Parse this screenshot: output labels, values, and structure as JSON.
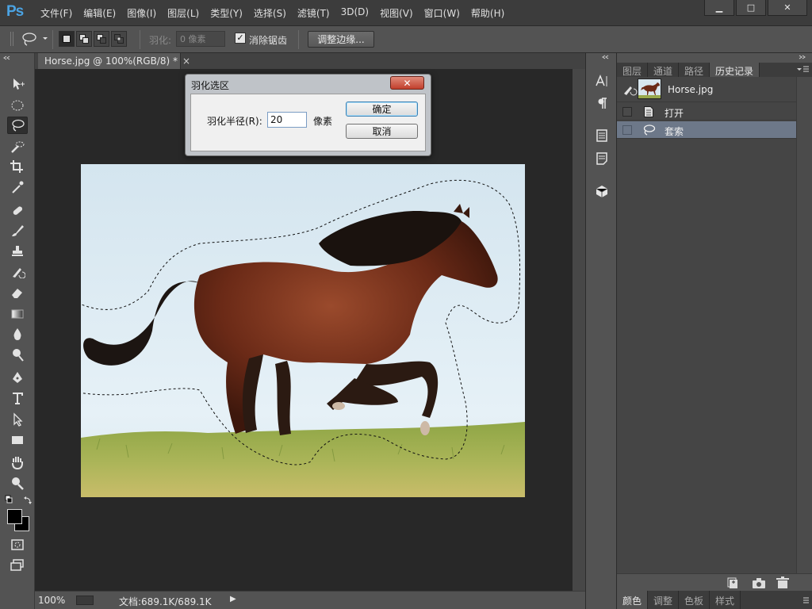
{
  "app": {
    "logo": "Ps"
  },
  "menus": [
    "文件(F)",
    "编辑(E)",
    "图像(I)",
    "图层(L)",
    "类型(Y)",
    "选择(S)",
    "滤镜(T)",
    "3D(D)",
    "视图(V)",
    "窗口(W)",
    "帮助(H)"
  ],
  "window_controls": {
    "minimize": "▁",
    "maximize": "□",
    "close": "✕"
  },
  "options": {
    "feather_label": "羽化:",
    "feather_value": "0 像素",
    "antialias_label": "消除锯齿",
    "antialias_checked": true,
    "antialias_mark": "✓",
    "refine_edge_label": "调整边缘..."
  },
  "document": {
    "tab_title": "Horse.jpg @ 100%(RGB/8) *",
    "tab_close": "×",
    "zoom": "100%",
    "doc_size": "文档:689.1K/689.1K"
  },
  "panel_tabs": [
    "图层",
    "通道",
    "路径",
    "历史记录"
  ],
  "history": {
    "snapshot": "Horse.jpg",
    "items": [
      {
        "label": "打开",
        "icon": "document-icon",
        "selected": false
      },
      {
        "label": "套索",
        "icon": "lasso-icon",
        "selected": true
      }
    ]
  },
  "bottom_tabs": [
    "颜色",
    "调整",
    "色板",
    "样式"
  ],
  "dialog": {
    "title": "羽化选区",
    "close": "✕",
    "radius_label": "羽化半径(R):",
    "radius_value": "20",
    "unit": "像素",
    "ok": "确定",
    "cancel": "取消"
  }
}
